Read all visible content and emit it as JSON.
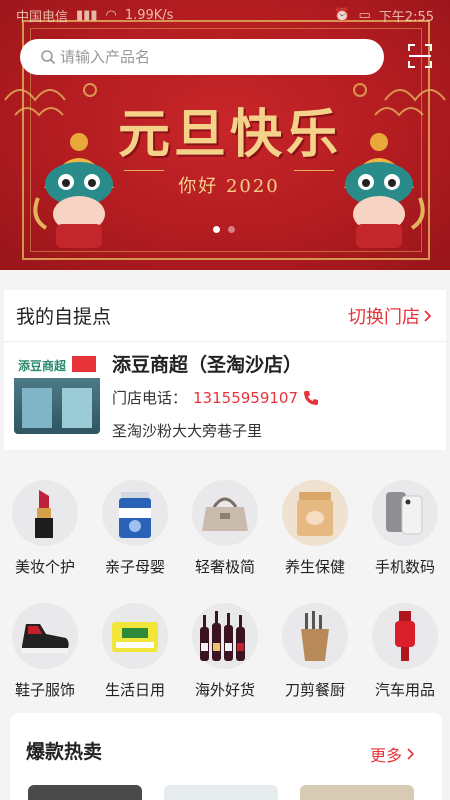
{
  "status_bar": {
    "carrier": "中国电信",
    "speed": "1.99K/s",
    "time": "下午2:55"
  },
  "search": {
    "placeholder": "请输入产品名"
  },
  "banner": {
    "title": "元旦快乐",
    "subtitle": "你好 2020",
    "slide_count": 2,
    "active_slide": 1
  },
  "pickup": {
    "title": "我的自提点",
    "switch_label": "切换门店",
    "store_name": "添豆商超（圣淘沙店）",
    "phone_label": "门店电话：",
    "phone": "13155959107",
    "address": "圣淘沙粉大大旁巷子里",
    "store_sign": "添豆商超"
  },
  "categories": [
    {
      "label": "美妆个护",
      "icon": "lipstick-icon"
    },
    {
      "label": "亲子母婴",
      "icon": "milk-powder-icon"
    },
    {
      "label": "轻奢极简",
      "icon": "handbag-icon"
    },
    {
      "label": "养生保健",
      "icon": "health-jar-icon"
    },
    {
      "label": "手机数码",
      "icon": "smartphone-icon"
    },
    {
      "label": "鞋子服饰",
      "icon": "sneaker-icon"
    },
    {
      "label": "生活日用",
      "icon": "tissue-pack-icon"
    },
    {
      "label": "海外好货",
      "icon": "wine-bottles-icon"
    },
    {
      "label": "刀剪餐厨",
      "icon": "knife-block-icon"
    },
    {
      "label": "汽车用品",
      "icon": "car-accessory-icon"
    }
  ],
  "hot_sale": {
    "title": "爆款热卖",
    "more_label": "更多"
  },
  "colors": {
    "accent": "#e7333a",
    "banner_red": "#b21c20",
    "banner_gold": "#f5d28a"
  }
}
